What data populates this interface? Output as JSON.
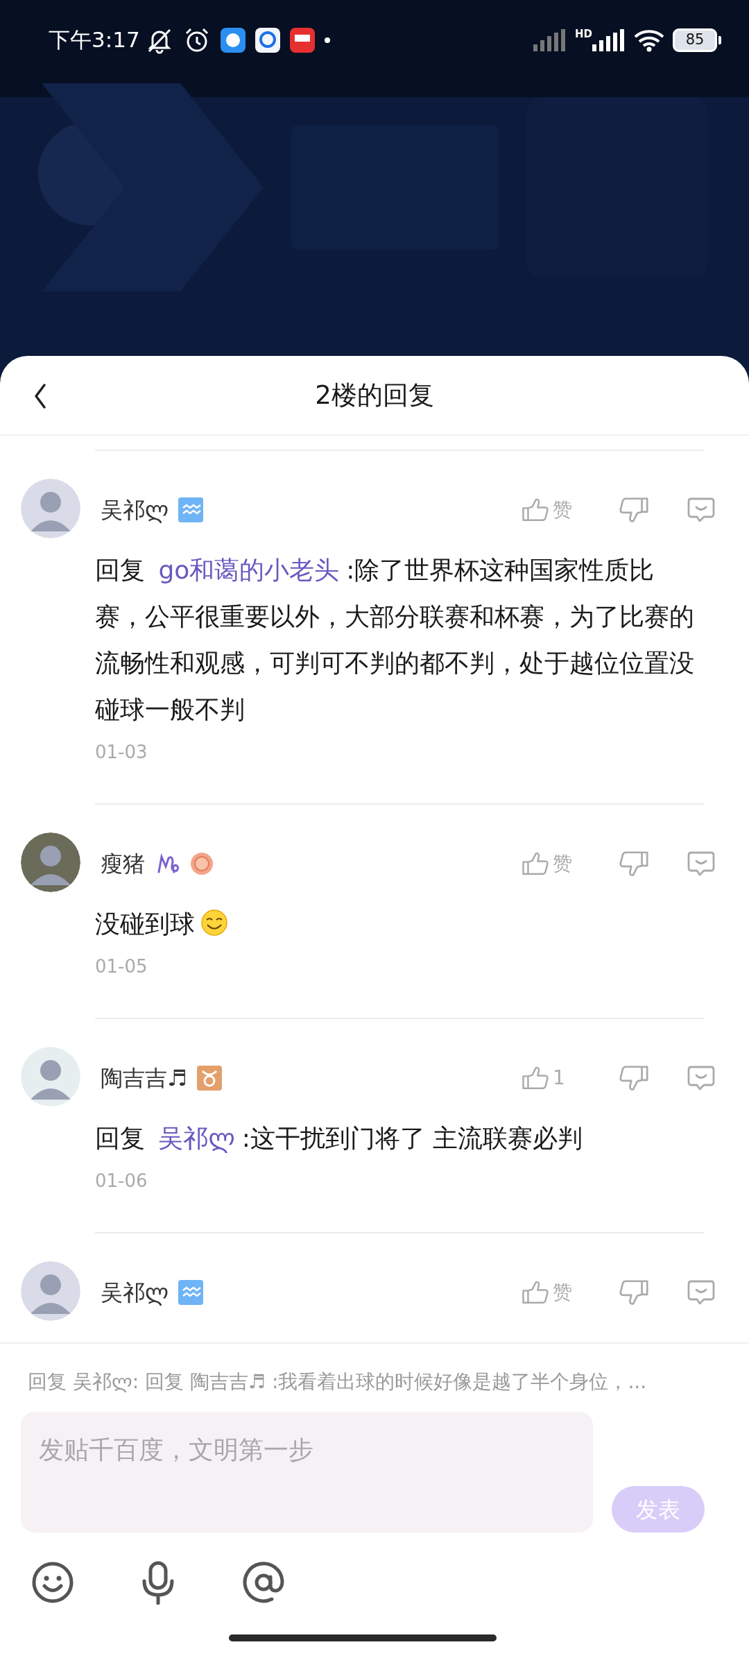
{
  "status_bar": {
    "time": "下午3:17",
    "network_label": "HD",
    "battery": "85"
  },
  "header": {
    "title": "2楼的回复"
  },
  "comments": [
    {
      "username": "吴祁ლ",
      "badges": [
        {
          "kind": "aquarius"
        }
      ],
      "like": "赞",
      "reply_label": "回复",
      "reply_to": "go和蔼的小老头",
      "text": ":除了世界杯这种国家性质比赛，公平很重要以外，大部分联赛和杯赛，为了比赛的流畅性和观感，可判可不判的都不判，处于越位位置没碰球一般不判",
      "has_emoji": false,
      "date": "01-03"
    },
    {
      "username": "瘦猪",
      "badges": [
        {
          "kind": "capricorn"
        },
        {
          "kind": "medal"
        }
      ],
      "like": "赞",
      "text": "没碰到球",
      "has_emoji": true,
      "date": "01-05"
    },
    {
      "username": "陶吉吉♬",
      "badges": [
        {
          "kind": "taurus"
        }
      ],
      "like": "1",
      "reply_label": "回复",
      "reply_to": "吴祁ლ",
      "text": ":这干扰到门将了 主流联赛必判",
      "has_emoji": false,
      "date": "01-06"
    },
    {
      "username": "吴祁ლ",
      "badges": [
        {
          "kind": "aquarius"
        }
      ],
      "like": "赞"
    }
  ],
  "composer": {
    "reply_preview": "回复 吴祁ლ: 回复 陶吉吉♬ :我看着出球的时候好像是越了半个身位，...",
    "placeholder": "发贴千百度，文明第一步",
    "send_label": "发表"
  }
}
